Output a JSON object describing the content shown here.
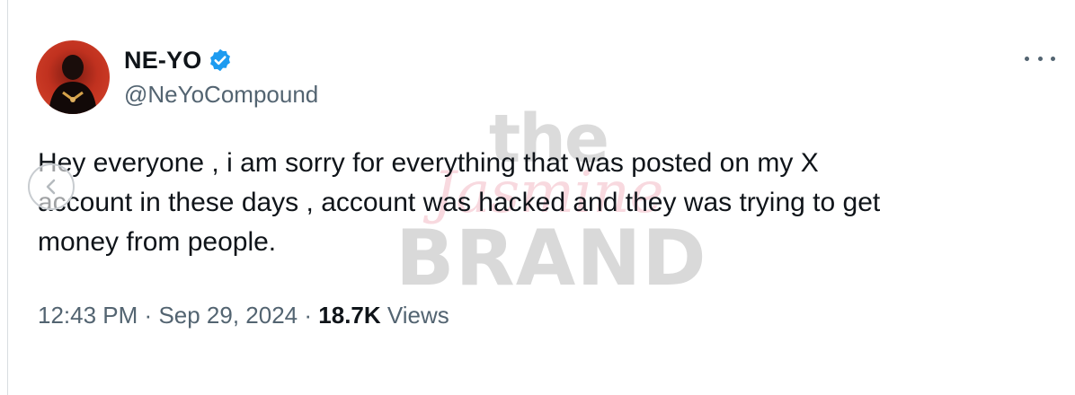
{
  "profile": {
    "display_name": "NE-YO",
    "handle": "@NeYoCompound",
    "avatar_icon": "avatar-photo",
    "verified_icon": "verified-badge-icon",
    "verified_color": "#1d9bf0"
  },
  "menu": {
    "more_icon": "more-options-icon"
  },
  "tweet": {
    "lines": [
      "Hey everyone , i am sorry for everything that was posted on my X",
      "account in these days , account was hacked and they was trying to get",
      "money from people."
    ]
  },
  "meta": {
    "time": "12:43 PM",
    "separator": "·",
    "date": "Sep 29, 2024",
    "views_count": "18.7K",
    "views_label": "Views"
  },
  "watermark": {
    "line1": "the",
    "line2": "Jasmine",
    "line3": "BRAND"
  },
  "carousel": {
    "prev_icon": "chevron-left-icon"
  }
}
